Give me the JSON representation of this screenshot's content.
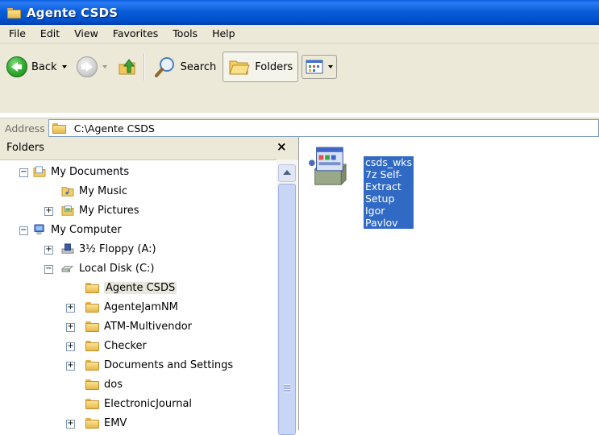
{
  "window": {
    "title": "Agente CSDS"
  },
  "menu": [
    "File",
    "Edit",
    "View",
    "Favorites",
    "Tools",
    "Help"
  ],
  "toolbar": {
    "back_label": "Back",
    "search_label": "Search",
    "folders_label": "Folders"
  },
  "address": {
    "label": "Address",
    "value": "C:\\Agente CSDS"
  },
  "folders_pane": {
    "title": "Folders",
    "close": "×",
    "items": [
      {
        "label": "My Documents",
        "icon": "my-documents-icon"
      },
      {
        "label": "My Music",
        "icon": "my-music-icon"
      },
      {
        "label": "My Pictures",
        "icon": "my-pictures-icon"
      },
      {
        "label": "My Computer",
        "icon": "my-computer-icon"
      },
      {
        "label": "3½ Floppy (A:)",
        "icon": "floppy-drive-icon"
      },
      {
        "label": "Local Disk (C:)",
        "icon": "hard-disk-icon"
      },
      {
        "label": "Agente CSDS",
        "icon": "folder-icon"
      },
      {
        "label": "AgenteJamNM",
        "icon": "folder-icon"
      },
      {
        "label": "ATM-Multivendor",
        "icon": "folder-icon"
      },
      {
        "label": "Checker",
        "icon": "folder-icon"
      },
      {
        "label": "Documents and Settings",
        "icon": "folder-icon"
      },
      {
        "label": "dos",
        "icon": "folder-icon"
      },
      {
        "label": "ElectronicJournal",
        "icon": "folder-icon"
      },
      {
        "label": "EMV",
        "icon": "folder-icon"
      }
    ]
  },
  "content": {
    "files": [
      {
        "name": "csds_wks",
        "type": "7z Self-Extract Setup",
        "company": "Igor Pavlov"
      }
    ]
  },
  "colors": {
    "titlebar": "#0a5ed8",
    "selection": "#316ac5",
    "chrome": "#ece9d8"
  }
}
